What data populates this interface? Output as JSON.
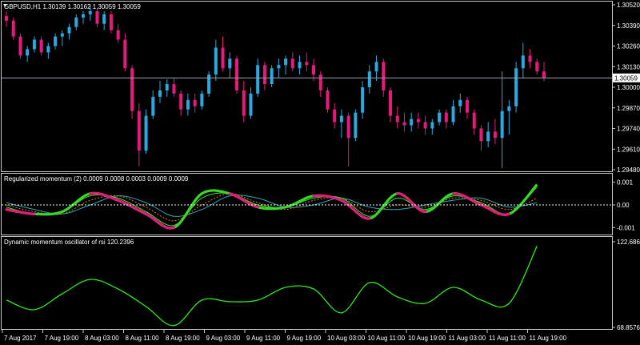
{
  "colors": {
    "background": "#000000",
    "bull": "#29a9e0",
    "bear": "#e8197d",
    "signal": "#39d62b",
    "osc_line": "#2fe81a",
    "signal_slow": "#2aa7b8",
    "signal_orange": "#e07a14",
    "text": "#ffffff",
    "border": "#c8c8c8"
  },
  "main_panel": {
    "title": "GBPUSD,H1  1.30139 1.30162 1.30059 1.30059",
    "price_tag": "1.30059"
  },
  "momentum_panel": {
    "title": "Regularized momentum (2) 0.0009 0.0008 0.0003 0.0009 0.0009"
  },
  "osc_panel": {
    "title": "Dynamic momentum oscillator of rsi 120.2396"
  },
  "chart_data": [
    {
      "type": "candlestick",
      "title": "GBPUSD,H1  1.30139 1.30162 1.30059 1.30059",
      "ylim": [
        1.2948,
        1.3052
      ],
      "yticks": [
        "1.30520",
        "1.30390",
        "1.30260",
        "1.30130",
        "1.30000",
        "1.29870",
        "1.29740",
        "1.29610",
        "1.29480"
      ],
      "current_price": 1.30059,
      "bars": [
        [
          1.3045,
          1.3048,
          1.3038,
          1.3042
        ],
        [
          1.3042,
          1.3044,
          1.303,
          1.3032
        ],
        [
          1.3032,
          1.3034,
          1.3018,
          1.302
        ],
        [
          1.302,
          1.3026,
          1.3016,
          1.3024
        ],
        [
          1.3024,
          1.3032,
          1.3022,
          1.303
        ],
        [
          1.303,
          1.3032,
          1.302,
          1.3022
        ],
        [
          1.3022,
          1.3028,
          1.3018,
          1.3026
        ],
        [
          1.3026,
          1.3034,
          1.3024,
          1.3032
        ],
        [
          1.3032,
          1.3036,
          1.3026,
          1.3034
        ],
        [
          1.3034,
          1.304,
          1.303,
          1.3038
        ],
        [
          1.3038,
          1.3046,
          1.3036,
          1.3044
        ],
        [
          1.3044,
          1.3048,
          1.304,
          1.3046
        ],
        [
          1.3046,
          1.3052,
          1.3042,
          1.3048
        ],
        [
          1.3048,
          1.305,
          1.3038,
          1.304
        ],
        [
          1.304,
          1.3048,
          1.3036,
          1.3046
        ],
        [
          1.3046,
          1.3048,
          1.3034,
          1.3036
        ],
        [
          1.3036,
          1.304,
          1.3028,
          1.303
        ],
        [
          1.303,
          1.3034,
          1.301,
          1.3012
        ],
        [
          1.3012,
          1.3014,
          1.298,
          1.2985
        ],
        [
          1.2985,
          1.299,
          1.295,
          1.296
        ],
        [
          1.296,
          1.2986,
          1.2958,
          1.2982
        ],
        [
          1.2982,
          1.2998,
          1.298,
          1.2994
        ],
        [
          1.2994,
          1.3004,
          1.299,
          1.2998
        ],
        [
          1.2998,
          1.3005,
          1.2994,
          1.3002
        ],
        [
          1.3002,
          1.3006,
          1.2994,
          1.2996
        ],
        [
          1.2996,
          1.2998,
          1.2982,
          1.2986
        ],
        [
          1.2986,
          1.2996,
          1.2982,
          1.2992
        ],
        [
          1.2992,
          1.2996,
          1.2984,
          1.2988
        ],
        [
          1.2988,
          1.2998,
          1.2986,
          1.2996
        ],
        [
          1.2996,
          1.301,
          1.2994,
          1.3008
        ],
        [
          1.3008,
          1.303,
          1.3004,
          1.3025
        ],
        [
          1.3025,
          1.3032,
          1.301,
          1.3012
        ],
        [
          1.3012,
          1.3022,
          1.3006,
          1.3018
        ],
        [
          1.3018,
          1.302,
          1.2996,
          1.2998
        ],
        [
          1.2998,
          1.3004,
          1.2978,
          1.2982
        ],
        [
          1.2982,
          1.3,
          1.298,
          1.2996
        ],
        [
          1.2996,
          1.3018,
          1.2994,
          1.3014
        ],
        [
          1.3014,
          1.3016,
          1.2998,
          1.3002
        ],
        [
          1.3002,
          1.3014,
          1.3,
          1.3012
        ],
        [
          1.3012,
          1.3018,
          1.3006,
          1.3014
        ],
        [
          1.3014,
          1.302,
          1.3008,
          1.3018
        ],
        [
          1.3018,
          1.3022,
          1.301,
          1.3012
        ],
        [
          1.3012,
          1.302,
          1.3008,
          1.3016
        ],
        [
          1.3016,
          1.3022,
          1.301,
          1.3014
        ],
        [
          1.3014,
          1.3018,
          1.3004,
          1.3008
        ],
        [
          1.3008,
          1.301,
          1.2994,
          1.2998
        ],
        [
          1.2998,
          1.3,
          1.2984,
          1.2986
        ],
        [
          1.2986,
          1.299,
          1.2974,
          1.2978
        ],
        [
          1.2978,
          1.2986,
          1.2968,
          1.2982
        ],
        [
          1.2982,
          1.2984,
          1.295,
          1.2968
        ],
        [
          1.2968,
          1.2986,
          1.2966,
          1.2984
        ],
        [
          1.2984,
          1.3004,
          1.298,
          1.3
        ],
        [
          1.3,
          1.3014,
          1.2996,
          1.301
        ],
        [
          1.301,
          1.302,
          1.3004,
          1.3016
        ],
        [
          1.3016,
          1.3018,
          1.2994,
          1.2998
        ],
        [
          1.2998,
          1.3,
          1.2978,
          1.2982
        ],
        [
          1.2982,
          1.2988,
          1.2974,
          1.2978
        ],
        [
          1.2978,
          1.2984,
          1.2972,
          1.2976
        ],
        [
          1.2976,
          1.2984,
          1.2972,
          1.298
        ],
        [
          1.298,
          1.2984,
          1.2974,
          1.2978
        ],
        [
          1.2978,
          1.2982,
          1.297,
          1.2974
        ],
        [
          1.2974,
          1.298,
          1.297,
          1.2978
        ],
        [
          1.2978,
          1.2986,
          1.2976,
          1.2984
        ],
        [
          1.2984,
          1.2986,
          1.2974,
          1.2978
        ],
        [
          1.2978,
          1.2992,
          1.2976,
          1.2988
        ],
        [
          1.2988,
          1.2996,
          1.2984,
          1.2992
        ],
        [
          1.2992,
          1.2994,
          1.298,
          1.2984
        ],
        [
          1.2984,
          1.2986,
          1.297,
          1.2974
        ],
        [
          1.2974,
          1.2976,
          1.296,
          1.2966
        ],
        [
          1.2966,
          1.2978,
          1.2962,
          1.2972
        ],
        [
          1.2972,
          1.298,
          1.2964,
          1.2968
        ],
        [
          1.2968,
          1.301,
          1.2949,
          1.2985
        ],
        [
          1.2985,
          1.2992,
          1.297,
          1.2988
        ],
        [
          1.2988,
          1.3016,
          1.2984,
          1.3012
        ],
        [
          1.3012,
          1.3028,
          1.3006,
          1.302
        ],
        [
          1.302,
          1.3024,
          1.3012,
          1.3016
        ],
        [
          1.3016,
          1.3018,
          1.3008,
          1.301
        ],
        [
          1.301,
          1.3016,
          1.3004,
          1.3006
        ]
      ]
    },
    {
      "type": "line",
      "title": "Regularized momentum (2) 0.0009 0.0008 0.0003 0.0009 0.0009",
      "ylim": [
        -0.0012,
        0.0012
      ],
      "yticks": [
        "0.001",
        "0.00",
        "-0.001"
      ],
      "x": [
        0,
        4,
        8,
        12,
        16,
        20,
        24,
        28,
        32,
        36,
        40,
        44,
        48,
        52,
        56,
        60,
        64,
        68,
        72,
        76
      ],
      "series": [
        {
          "values": [
            -0.0002,
            -0.0004,
            -0.0003,
            0.0005,
            0.0002,
            -0.0004,
            -0.001,
            0.0005,
            0.0005,
            -0.0001,
            -0.0001,
            0.0004,
            0.0002,
            -0.0006,
            0.0005,
            -0.0003,
            0.0005,
            0.0,
            -0.0004,
            0.0009
          ]
        },
        {
          "values": [
            -0.0001,
            -0.0004,
            -0.0003,
            0.0004,
            0.0003,
            -0.0003,
            -0.0009,
            0.0003,
            0.0005,
            0.0,
            -0.0001,
            0.0003,
            0.0003,
            -0.0005,
            0.0003,
            -0.0002,
            0.0004,
            0.0001,
            -0.0004,
            0.0008
          ]
        },
        {
          "values": [
            0.0,
            -0.0003,
            -0.0004,
            0.0002,
            0.0004,
            -0.0001,
            -0.0007,
            0.0,
            0.0005,
            0.0001,
            -0.0002,
            0.0002,
            0.0003,
            -0.0003,
            0.0,
            -0.0001,
            0.0003,
            0.0002,
            -0.0002,
            0.0003
          ]
        },
        {
          "values": [
            0.0001,
            -0.0002,
            -0.0004,
            0.0,
            0.0004,
            0.0001,
            -0.0005,
            -0.0002,
            0.0004,
            0.0003,
            -0.0001,
            0.0,
            0.0003,
            -0.0001,
            -0.0002,
            0.0,
            0.0002,
            0.0003,
            -0.0001,
            0.0001
          ]
        }
      ]
    },
    {
      "type": "line",
      "title": "Dynamic momentum oscillator of rsi 120.2396",
      "ylim": [
        68.8576,
        122.6863
      ],
      "yticks": [
        "122.6863",
        "68.8576"
      ],
      "x": [
        0,
        4,
        8,
        12,
        16,
        20,
        24,
        28,
        32,
        36,
        40,
        44,
        48,
        52,
        56,
        60,
        64,
        68,
        72,
        76
      ],
      "series": [
        {
          "values": [
            86,
            80,
            90,
            99,
            93,
            82,
            70,
            86,
            85,
            86,
            94,
            93,
            78,
            97,
            88,
            84,
            94,
            86,
            84,
            120
          ]
        }
      ]
    }
  ],
  "x_axis": {
    "labels": [
      "7 Aug 2017",
      "7 Aug 19:00",
      "8 Aug 03:00",
      "8 Aug 11:00",
      "8 Aug 19:00",
      "9 Aug 03:00",
      "9 Aug 11:00",
      "9 Aug 19:00",
      "10 Aug 03:00",
      "10 Aug 11:00",
      "10 Aug 19:00",
      "11 Aug 03:00",
      "11 Aug 11:00",
      "11 Aug 19:00"
    ]
  }
}
